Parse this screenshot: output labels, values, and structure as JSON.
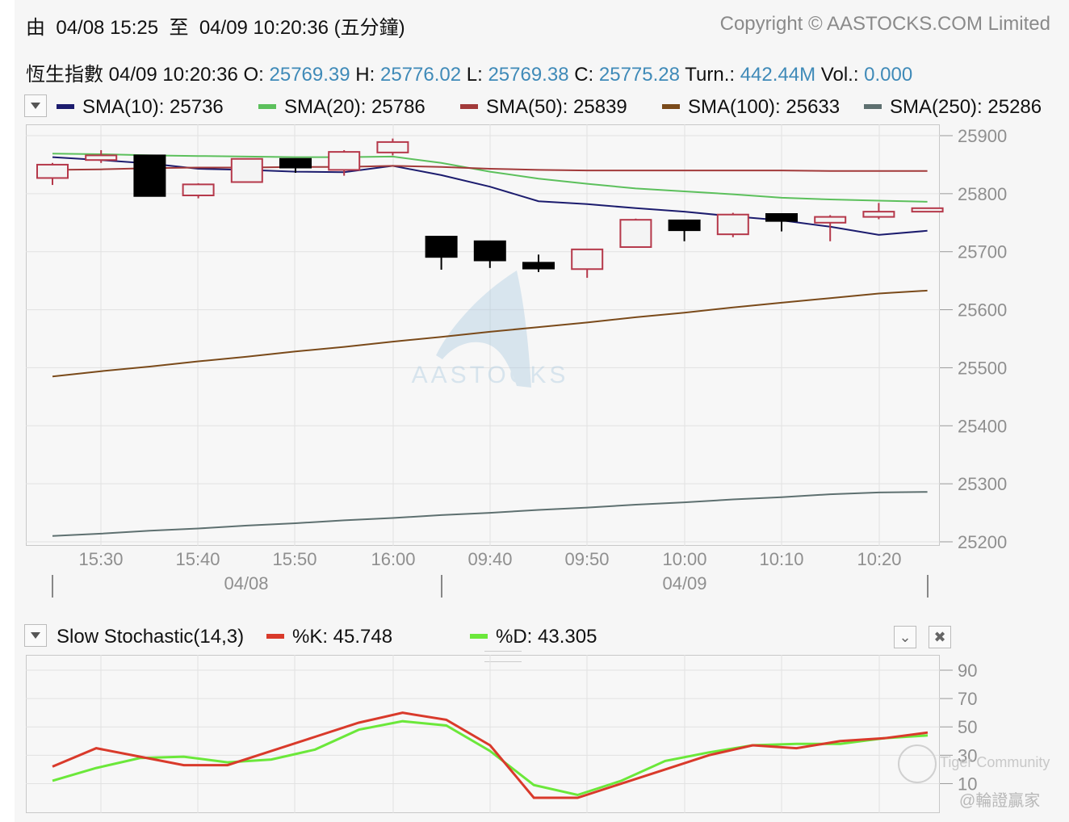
{
  "header": {
    "range_prefix": "由",
    "range_from": "04/08 15:25",
    "range_sep": "至",
    "range_to": "04/09 10:20:36",
    "interval": "(五分鐘)",
    "copyright": "Copyright © AASTOCKS.COM Limited"
  },
  "quote": {
    "name": "恆生指數",
    "time": "04/09 10:20:36",
    "open_label": "O:",
    "open": "25769.39",
    "high_label": "H:",
    "high": "25776.02",
    "low_label": "L:",
    "low": "25769.38",
    "close_label": "C:",
    "close": "25775.28",
    "turn_label": "Turn.:",
    "turn": "442.44M",
    "vol_label": "Vol.:",
    "vol": "0.000"
  },
  "sma_legend": [
    {
      "label": "SMA(10): 25736",
      "color": "#1c1c6e"
    },
    {
      "label": "SMA(20): 25786",
      "color": "#5cc05c"
    },
    {
      "label": "SMA(50): 25839",
      "color": "#a23a3a"
    },
    {
      "label": "SMA(100): 25633",
      "color": "#7a4a1a"
    },
    {
      "label": "SMA(250): 25286",
      "color": "#5e7070"
    }
  ],
  "watermark": "AASTOCKS",
  "stoch": {
    "title": "Slow Stochastic(14,3)",
    "k_label": "%K: 45.748",
    "k_color": "#d93a2b",
    "d_label": "%D: 43.305",
    "d_color": "#6be83a"
  },
  "corner_watermark": {
    "line1": "Tiger Community",
    "line2": "@輪證贏家"
  },
  "chart_data": [
    {
      "type": "candlestick",
      "x_tick_labels": [
        "15:30",
        "15:40",
        "15:50",
        "16:00",
        "09:40",
        "09:50",
        "10:00",
        "10:10",
        "10:20"
      ],
      "date_labels": [
        "04/08",
        "04/09"
      ],
      "y_ticks": [
        25900,
        25800,
        25700,
        25600,
        25500,
        25400,
        25300,
        25200
      ],
      "ylim": [
        25200,
        25900
      ],
      "up_color": "#b5384a",
      "down_color": "#000000",
      "candles": [
        {
          "o": 25827,
          "h": 25853,
          "l": 25815,
          "c": 25850
        },
        {
          "o": 25858,
          "h": 25875,
          "l": 25853,
          "c": 25866
        },
        {
          "o": 25866,
          "h": 25866,
          "l": 25796,
          "c": 25796
        },
        {
          "o": 25797,
          "h": 25818,
          "l": 25792,
          "c": 25816
        },
        {
          "o": 25820,
          "h": 25860,
          "l": 25820,
          "c": 25860
        },
        {
          "o": 25860,
          "h": 25860,
          "l": 25836,
          "c": 25845
        },
        {
          "o": 25841,
          "h": 25875,
          "l": 25831,
          "c": 25872
        },
        {
          "o": 25871,
          "h": 25895,
          "l": 25866,
          "c": 25889
        },
        {
          "o": 25726,
          "h": 25726,
          "l": 25669,
          "c": 25691
        },
        {
          "o": 25718,
          "h": 25718,
          "l": 25672,
          "c": 25685
        },
        {
          "o": 25681,
          "h": 25695,
          "l": 25665,
          "c": 25671
        },
        {
          "o": 25670,
          "h": 25705,
          "l": 25655,
          "c": 25704
        },
        {
          "o": 25708,
          "h": 25757,
          "l": 25708,
          "c": 25755
        },
        {
          "o": 25754,
          "h": 25755,
          "l": 25718,
          "c": 25737
        },
        {
          "o": 25730,
          "h": 25767,
          "l": 25725,
          "c": 25764
        },
        {
          "o": 25765,
          "h": 25766,
          "l": 25735,
          "c": 25753
        },
        {
          "o": 25750,
          "h": 25763,
          "l": 25718,
          "c": 25760
        },
        {
          "o": 25760,
          "h": 25784,
          "l": 25756,
          "c": 25769
        },
        {
          "o": 25769,
          "h": 25776,
          "l": 25769,
          "c": 25775
        }
      ],
      "series": [
        {
          "name": "SMA(10)",
          "color": "#1c1c6e",
          "values": [
            25863,
            25858,
            25852,
            25843,
            25841,
            25838,
            25837,
            25848,
            25832,
            25812,
            25787,
            25782,
            25775,
            25769,
            25761,
            25754,
            25743,
            25729,
            25736
          ]
        },
        {
          "name": "SMA(20)",
          "color": "#5cc05c",
          "values": [
            25869,
            25868,
            25866,
            25865,
            25864,
            25863,
            25863,
            25864,
            25853,
            25838,
            25826,
            25817,
            25809,
            25804,
            25799,
            25793,
            25790,
            25788,
            25786
          ]
        },
        {
          "name": "SMA(50)",
          "color": "#a23a3a",
          "values": [
            25841,
            25842,
            25844,
            25845,
            25845,
            25846,
            25846,
            25848,
            25846,
            25843,
            25841,
            25840,
            25840,
            25840,
            25840,
            25840,
            25839,
            25839,
            25839
          ]
        },
        {
          "name": "SMA(100)",
          "color": "#7a4a1a",
          "values": [
            25485,
            25494,
            25502,
            25511,
            25519,
            25528,
            25536,
            25545,
            25553,
            25562,
            25570,
            25578,
            25587,
            25595,
            25604,
            25612,
            25620,
            25628,
            25633
          ]
        },
        {
          "name": "SMA(250)",
          "color": "#5e7070",
          "values": [
            25210,
            25214,
            25219,
            25223,
            25228,
            25232,
            25237,
            25241,
            25246,
            25250,
            25255,
            25259,
            25264,
            25268,
            25273,
            25277,
            25282,
            25285,
            25286
          ]
        }
      ]
    },
    {
      "type": "line",
      "y_ticks": [
        90,
        70,
        50,
        30,
        10
      ],
      "ylim": [
        0,
        100
      ],
      "series": [
        {
          "name": "%K",
          "color": "#d93a2b",
          "values": [
            22,
            35,
            29,
            23,
            23,
            33,
            43,
            53,
            60,
            55,
            37,
            0,
            0,
            10,
            20,
            30,
            37,
            35,
            40,
            42,
            46
          ]
        },
        {
          "name": "%D",
          "color": "#6be83a",
          "values": [
            12,
            21,
            28,
            29,
            25,
            27,
            34,
            48,
            54,
            51,
            33,
            9,
            2,
            12,
            26,
            32,
            37,
            38,
            38,
            42,
            44
          ]
        }
      ]
    }
  ]
}
